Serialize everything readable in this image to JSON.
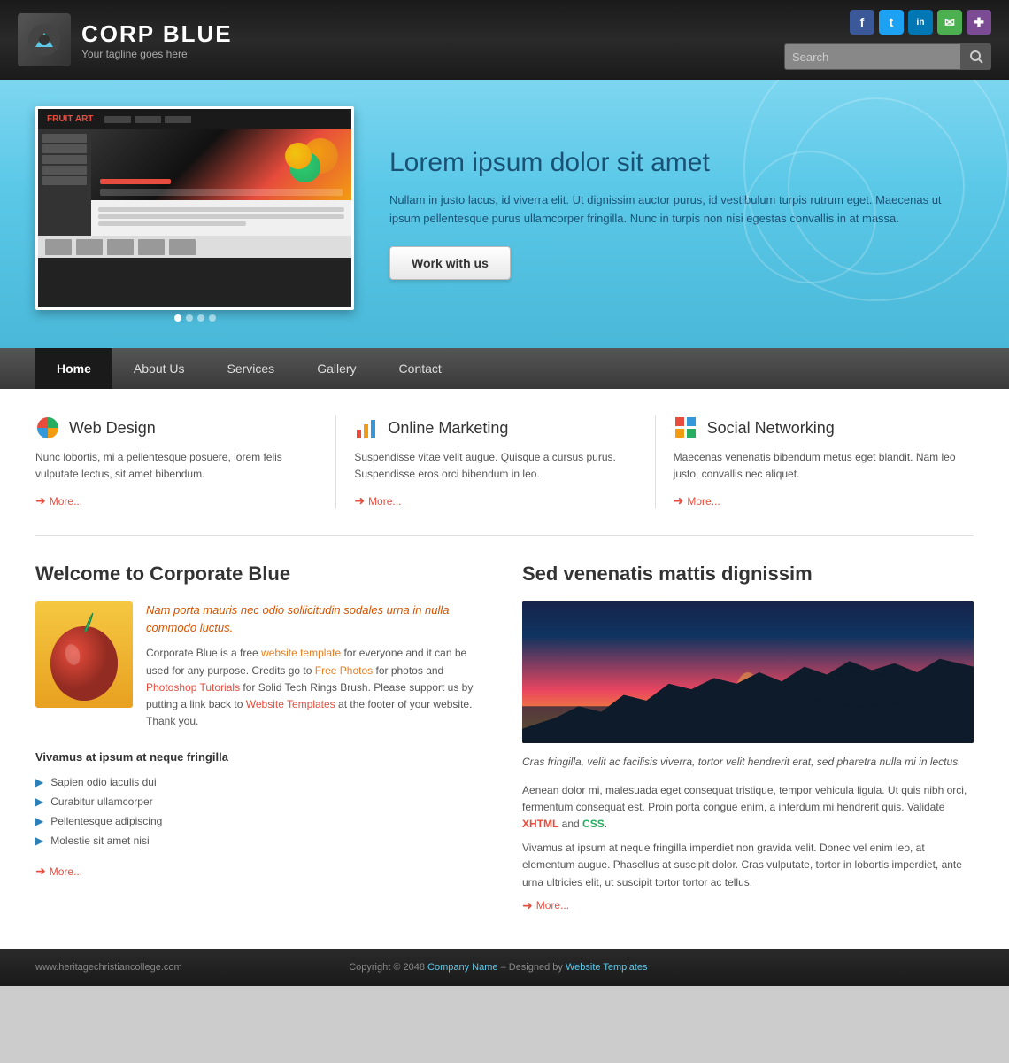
{
  "header": {
    "logo_title": "CORP BLUE",
    "logo_tagline": "Your tagline goes here",
    "search_placeholder": "Search",
    "search_btn_icon": "🔍"
  },
  "social": {
    "icons": [
      {
        "name": "facebook",
        "label": "f",
        "class": "social-fb"
      },
      {
        "name": "twitter",
        "label": "t",
        "class": "social-tw"
      },
      {
        "name": "linkedin",
        "label": "in",
        "class": "social-li"
      },
      {
        "name": "chat",
        "label": "✉",
        "class": "social-gp"
      },
      {
        "name": "rss",
        "label": "✚",
        "class": "social-rss"
      }
    ]
  },
  "hero": {
    "title": "Lorem ipsum dolor sit amet",
    "text": "Nullam in justo lacus, id viverra elit. Ut dignissim auctor purus, id vestibulum turpis rutrum eget. Maecenas ut ipsum pellentesque purus ullamcorper fringilla. Nunc in turpis non nisi egestas convallis in at massa.",
    "btn_label": "Work with us"
  },
  "nav": {
    "items": [
      {
        "label": "Home",
        "active": true
      },
      {
        "label": "About Us",
        "active": false
      },
      {
        "label": "Services",
        "active": false
      },
      {
        "label": "Gallery",
        "active": false
      },
      {
        "label": "Contact",
        "active": false
      }
    ]
  },
  "services": [
    {
      "title": "Web Design",
      "text": "Nunc lobortis, mi a pellentesque posuere, lorem felis vulputate lectus, sit amet bibendum.",
      "more": "More..."
    },
    {
      "title": "Online Marketing",
      "text": "Suspendisse vitae velit augue. Quisque a cursus purus. Suspendisse eros orci bibendum in leo.",
      "more": "More..."
    },
    {
      "title": "Social Networking",
      "text": "Maecenas venenatis bibendum metus eget blandit. Nam leo justo, convallis nec aliquet.",
      "more": "More..."
    }
  ],
  "left_section": {
    "title": "Welcome to Corporate Blue",
    "italic_text": "Nam porta mauris nec odio sollicitudin sodales urna in nulla commodo luctus.",
    "body_text1": "Corporate Blue is a free ",
    "link1": "website template",
    "body_text2": " for everyone and it can be used for any purpose. Credits go to ",
    "link2": "Free Photos",
    "body_text3": " for photos and ",
    "link3": "Photoshop Tutorials",
    "body_text4": " for Solid Tech Rings Brush. Please support us by putting a link back to ",
    "link4": "Website Templates",
    "body_text5": " at the footer of your website. Thank you.",
    "subsection_title": "Vivamus at ipsum at neque fringilla",
    "bullets": [
      "Sapien odio iaculis dui",
      "Curabitur ullamcorper",
      "Pellentesque adipiscing",
      "Molestie sit amet nisi"
    ],
    "more": "More..."
  },
  "right_section": {
    "title": "Sed venenatis mattis dignissim",
    "italic_text": "Cras fringilla, velit ac facilisis viverra, tortor velit hendrerit erat, sed pharetra nulla mi in lectus.",
    "body_text1": "Aenean dolor mi, malesuada eget consequat tristique, tempor vehicula ligula. Ut quis nibh orci, fermentum consequat est. Proin porta congue enim, a interdum mi hendrerit quis. Validate ",
    "xhtml": "XHTML",
    "and": " and ",
    "css": "CSS",
    "period": ".",
    "body_text2": "Vivamus at ipsum at neque fringilla imperdiet non gravida velit. Donec vel enim leo, at elementum augue. Phasellus at suscipit dolor. Cras vulputate, tortor in lobortis imperdiet, ante urna ultricies elit, ut suscipit tortor tortor ac tellus.",
    "more": "More..."
  },
  "footer": {
    "left": "www.heritagechristiancollege.com",
    "copyright": "Copyright © 2048 ",
    "company": "Company Name",
    "middle": " – Designed by ",
    "designer": "Website Templates"
  }
}
